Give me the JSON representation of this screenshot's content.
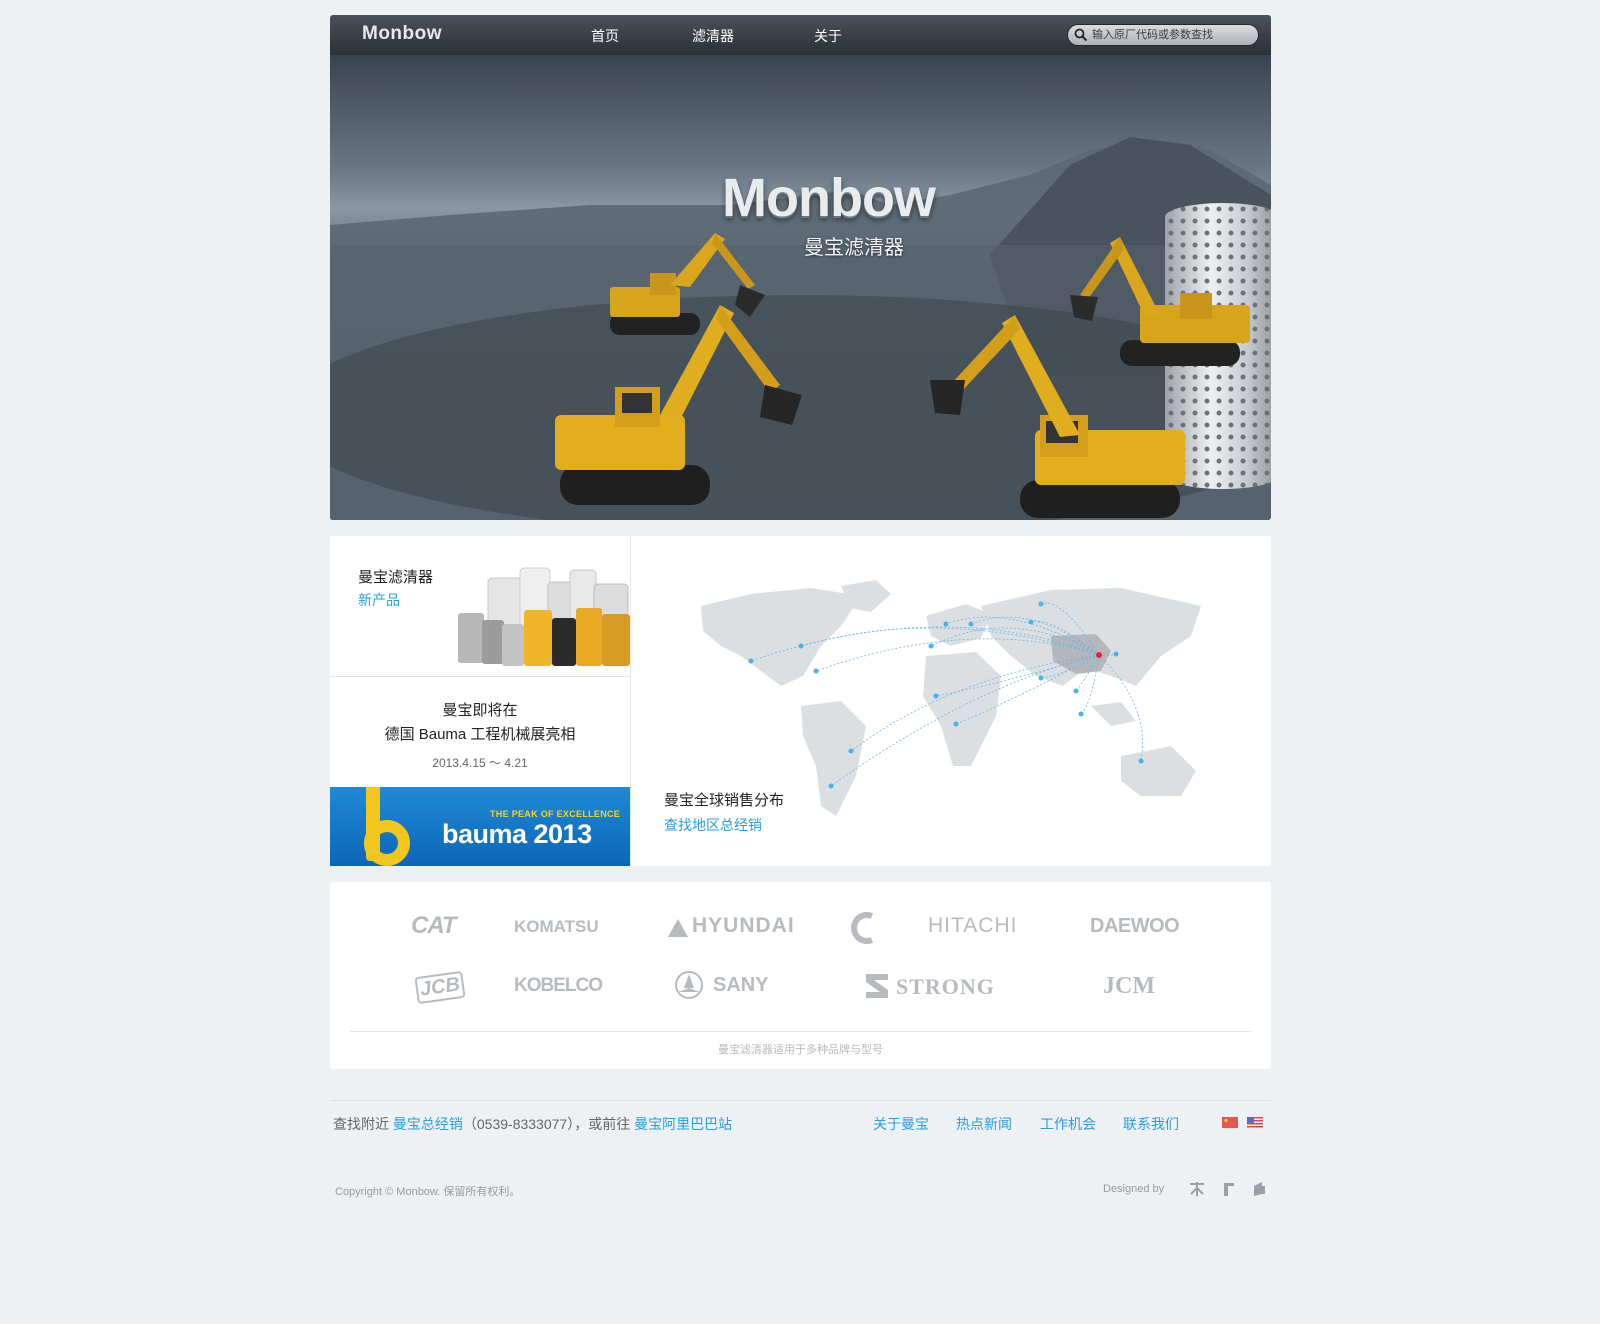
{
  "header": {
    "logo": "Monbow",
    "nav": [
      "首页",
      "滤清器",
      "关于"
    ],
    "search_placeholder": "输入原厂代码或参数查找"
  },
  "hero": {
    "logo": "Monbow",
    "subtitle": "曼宝滤清器"
  },
  "products": {
    "title": "曼宝滤清器",
    "link": "新产品"
  },
  "event": {
    "line1": "曼宝即将在",
    "line2": "德国 Bauma 工程机械展亮相",
    "date": "2013.4.15 ～ 4.21",
    "banner_tagline": "THE PEAK OF EXCELLENCE",
    "banner_name": "bauma 2013"
  },
  "map": {
    "title": "曼宝全球销售分布",
    "link": "查找地区总经销"
  },
  "brands": {
    "row1": [
      "CAT",
      "KOMATSU",
      "HYUNDAI",
      "HITACHI",
      "DAEWOO"
    ],
    "row2": [
      "JCB",
      "KOBELCO",
      "SANY",
      "STRONG",
      "JCM"
    ],
    "note": "曼宝滤清器适用于多种品牌与型号"
  },
  "footer": {
    "find_prefix": "查找附近 ",
    "dealer_link": "曼宝总经销",
    "phone": "（0539-8333077）",
    "goto": "，或前往 ",
    "alibaba_link": "曼宝阿里巴巴站",
    "nav": [
      "关于曼宝",
      "热点新闻",
      "工作机会",
      "联系我们"
    ],
    "copyright": "Copyright © Monbow. 保留所有权利。",
    "designed_by": "Designed by"
  },
  "colors": {
    "link": "#2a9fdc",
    "background": "#eef1f4",
    "topbar": "#2c3137"
  }
}
